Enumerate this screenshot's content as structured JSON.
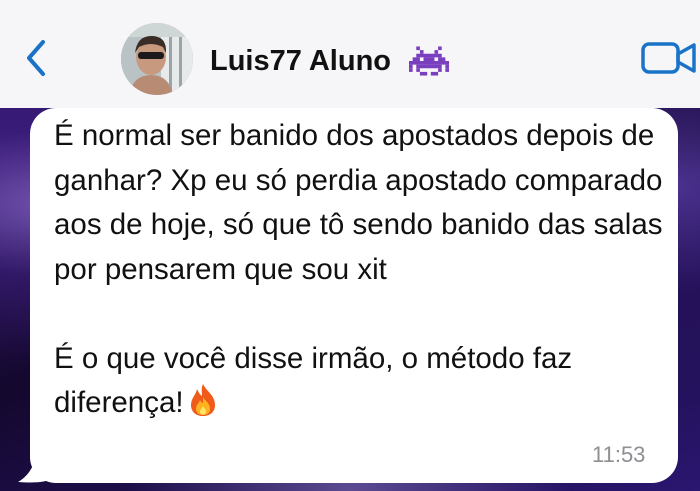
{
  "header": {
    "contact_name": "Luis77 Aluno",
    "back_icon": "chevron-left-icon",
    "video_icon": "video-camera-icon",
    "name_emoji_icon": "alien-monster-icon",
    "accent_color": "#1a73c7"
  },
  "message": {
    "paragraph_1": "É normal ser banido dos apostados depois de ganhar? Xp eu só perdia apostado comparado aos de hoje, só que tô sendo banido das salas por pensarem que sou xit",
    "paragraph_2": "É o que você disse irmão, o método faz diferença!",
    "trailing_emoji_icon": "fire-icon",
    "time": "11:53"
  }
}
